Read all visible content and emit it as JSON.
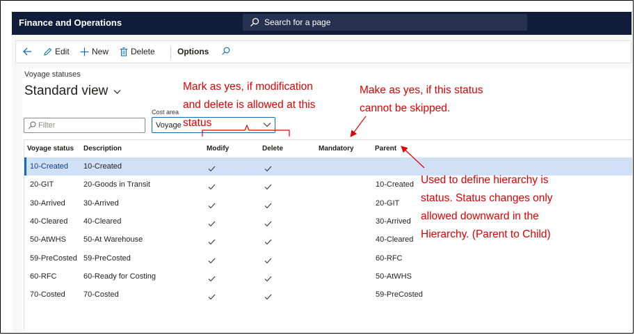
{
  "app": {
    "title": "Finance and Operations"
  },
  "search": {
    "placeholder": "Search for a page"
  },
  "actions": {
    "edit": "Edit",
    "new": "New",
    "delete": "Delete",
    "options": "Options"
  },
  "page": {
    "breadcrumb": "Voyage statuses",
    "view_title": "Standard view"
  },
  "filter": {
    "placeholder": "Filter"
  },
  "cost_area": {
    "label": "Cost area",
    "value": "Voyage"
  },
  "grid": {
    "headers": [
      "Voyage status",
      "Description",
      "Modify",
      "Delete",
      "Mandatory",
      "Parent"
    ],
    "rows": [
      {
        "status": "10-Created",
        "description": "10-Created",
        "modify": true,
        "delete": true,
        "mandatory": false,
        "parent": "",
        "selected": true
      },
      {
        "status": "20-GIT",
        "description": "20-Goods in Transit",
        "modify": true,
        "delete": true,
        "mandatory": false,
        "parent": "10-Created"
      },
      {
        "status": "30-Arrived",
        "description": "30-Arrived",
        "modify": true,
        "delete": true,
        "mandatory": false,
        "parent": "20-GIT"
      },
      {
        "status": "40-Cleared",
        "description": "40-Cleared",
        "modify": true,
        "delete": true,
        "mandatory": false,
        "parent": "30-Arrived"
      },
      {
        "status": "50-AtWHS",
        "description": "50-At Warehouse",
        "modify": true,
        "delete": true,
        "mandatory": false,
        "parent": "40-Cleared"
      },
      {
        "status": "59-PreCosted",
        "description": "59-PreCosted",
        "modify": true,
        "delete": true,
        "mandatory": false,
        "parent": "60-RFC"
      },
      {
        "status": "60-RFC",
        "description": "60-Ready for Costing",
        "modify": true,
        "delete": true,
        "mandatory": false,
        "parent": "50-AtWHS"
      },
      {
        "status": "70-Costed",
        "description": "70-Costed",
        "modify": true,
        "delete": true,
        "mandatory": false,
        "parent": "59-PreCosted"
      }
    ]
  },
  "annotations": {
    "modify_delete": "Mark as yes, if modification\nand delete is allowed at this\nstatus",
    "mandatory": "Make as yes, if this status\ncannot be skipped.",
    "parent": "Used to define hierarchy is\nstatus. Status changes only\nallowed downward in the\nHierarchy. (Parent to Child)"
  },
  "colors": {
    "topbar": "#0f1c3a",
    "accent": "#0f6cbd",
    "selected_row": "#cfe0f7",
    "annotation": "#e00000"
  }
}
